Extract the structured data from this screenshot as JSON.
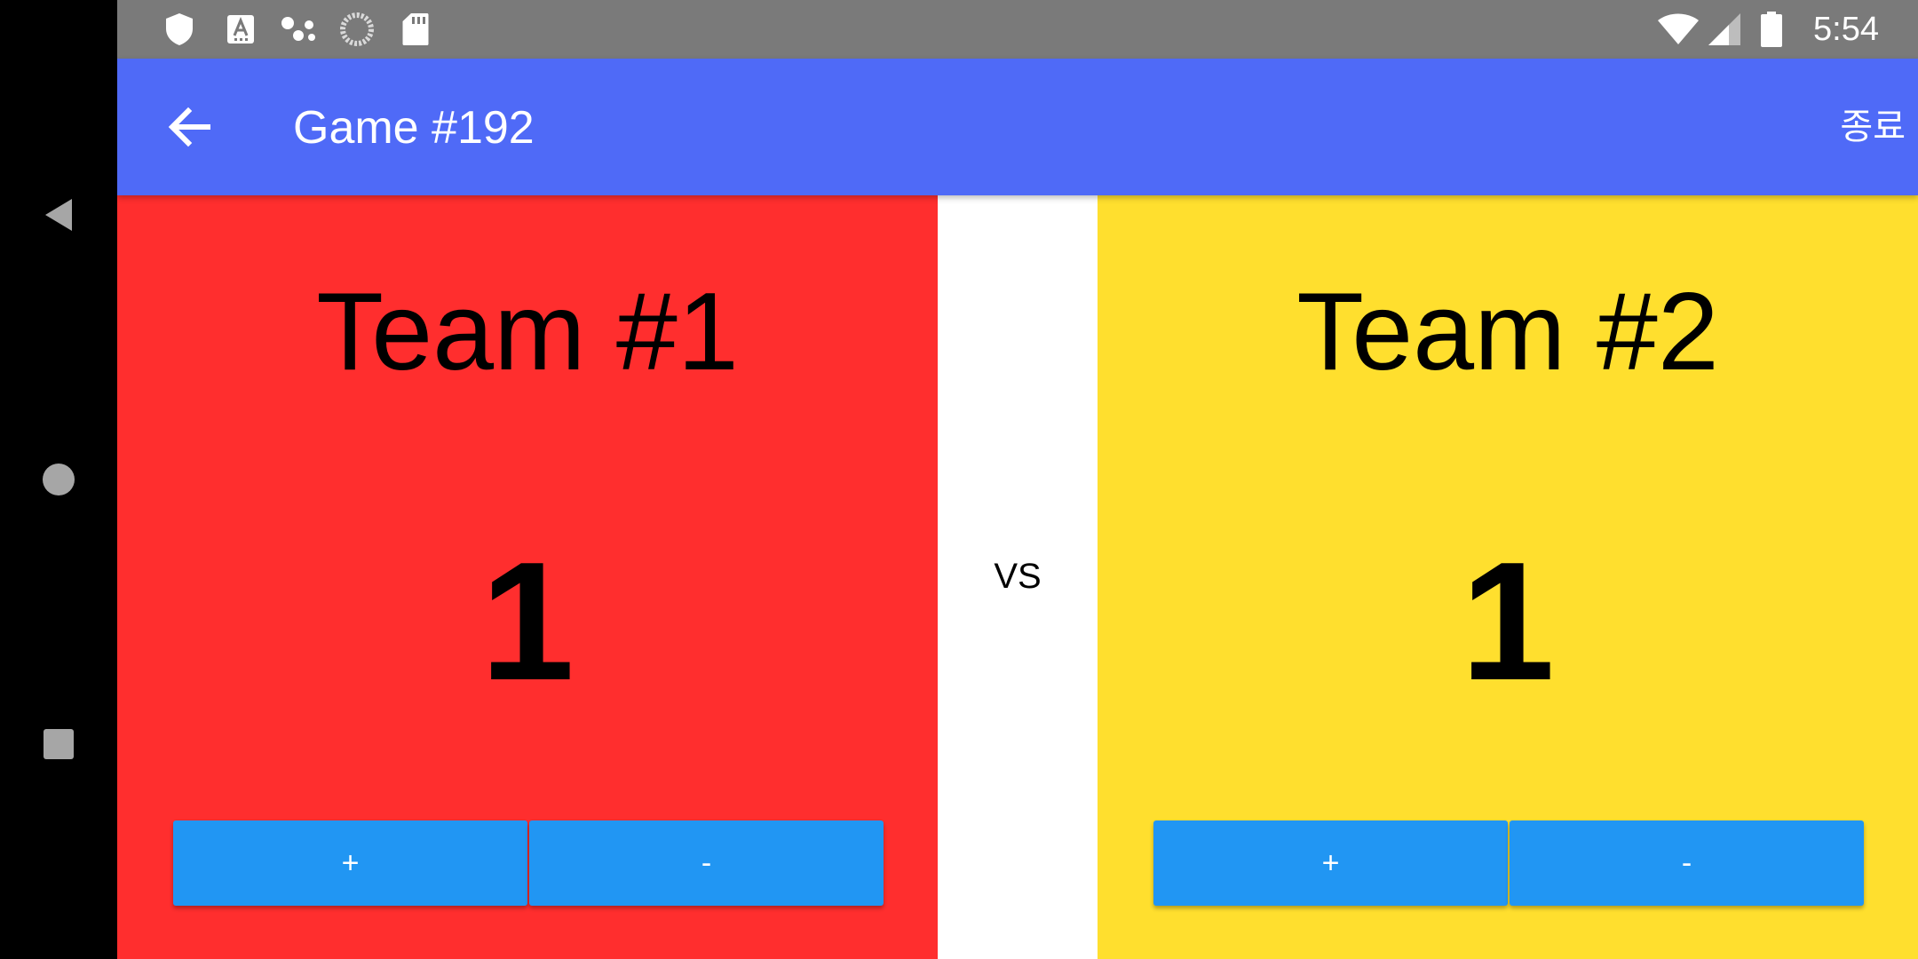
{
  "status_bar": {
    "time": "5:54",
    "left_icons": [
      "shield-icon",
      "keyboard-a-icon",
      "dots-icon",
      "loading-ring-icon",
      "sd-card-icon"
    ],
    "right_icons": [
      "wifi-icon",
      "cellular-signal-icon",
      "battery-icon"
    ]
  },
  "app_bar": {
    "title": "Game #192",
    "end_action": "종료"
  },
  "teams": [
    {
      "name": "Team #1",
      "score": "1",
      "plus_label": "+",
      "minus_label": "-"
    },
    {
      "name": "Team #2",
      "score": "1",
      "plus_label": "+",
      "minus_label": "-"
    }
  ],
  "vs_label": "VS",
  "colors": {
    "status_bar": "#7a7a7a",
    "app_bar": "#4f6af7",
    "team1_bg": "#ff2e2e",
    "team2_bg": "#ffdf2e",
    "button": "#2196f3",
    "nav_bar": "#000000"
  }
}
